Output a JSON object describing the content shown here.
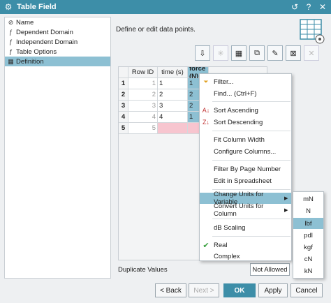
{
  "window": {
    "title": "Table Field",
    "help_icon": "reset-icon",
    "close_icon": "close-icon"
  },
  "tree": {
    "items": [
      {
        "label": "Name",
        "icon": "tag-icon"
      },
      {
        "label": "Dependent Domain",
        "icon": "fx-icon"
      },
      {
        "label": "Independent Domain",
        "icon": "fx-icon"
      },
      {
        "label": "Table Options",
        "icon": "fx-icon"
      },
      {
        "label": "Definition",
        "icon": "table-icon",
        "selected": true
      }
    ]
  },
  "main": {
    "description": "Define or edit data points."
  },
  "grid": {
    "headers": [
      "Row ID",
      "time (s)",
      "force (N) *"
    ],
    "rows": [
      {
        "num": "1",
        "id": "1",
        "time": "1",
        "force": "1"
      },
      {
        "num": "2",
        "id": "2",
        "time": "2",
        "force": "2"
      },
      {
        "num": "3",
        "id": "3",
        "time": "3",
        "force": "2"
      },
      {
        "num": "4",
        "id": "4",
        "time": "4",
        "force": "1"
      },
      {
        "num": "5",
        "id": "5",
        "time": "",
        "force": ""
      }
    ]
  },
  "context_menu": {
    "items": [
      {
        "label": "Filter...",
        "icon": "filter-icon"
      },
      {
        "label": "Find... (Ctrl+F)"
      },
      {
        "label": "Sort Ascending",
        "icon": "sort-asc-icon"
      },
      {
        "label": "Sort Descending",
        "icon": "sort-desc-icon"
      },
      {
        "label": "Fit Column Width"
      },
      {
        "label": "Configure Columns..."
      },
      {
        "label": "Filter By Page Number"
      },
      {
        "label": "Edit in Spreadsheet"
      },
      {
        "label": "Change Units for Variable",
        "submenu": true,
        "highlighted": true
      },
      {
        "label": "Convert Units for Column",
        "submenu": true
      },
      {
        "label": "dB Scaling"
      },
      {
        "label": "Real",
        "checked": true
      },
      {
        "label": "Complex"
      }
    ]
  },
  "units_submenu": {
    "items": [
      "mN",
      "N",
      "lbf",
      "pdl",
      "kgf",
      "cN",
      "kN"
    ],
    "highlighted": "lbf"
  },
  "footer": {
    "duplicate_label": "Duplicate Values",
    "duplicate_value": "Not Allowed"
  },
  "buttons": {
    "back": "< Back",
    "next": "Next >",
    "ok": "OK",
    "apply": "Apply",
    "cancel": "Cancel"
  },
  "colors": {
    "accent": "#3d8ea8",
    "highlight": "#8dc0d3",
    "pink": "#f7c5cf"
  }
}
